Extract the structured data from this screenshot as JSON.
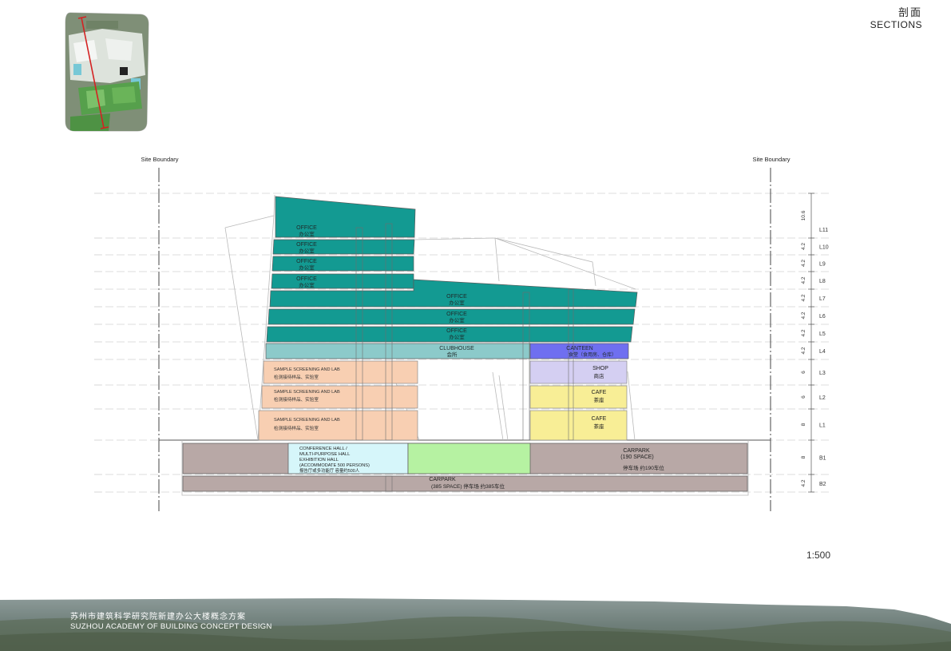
{
  "header": {
    "title_cn": "剖面",
    "title_en": "SECTIONS"
  },
  "boundary": {
    "left_label": "Site Boundary",
    "right_label": "Site Boundary"
  },
  "scale_text": "1:500",
  "footer": {
    "project_cn": "苏州市建筑科学研究院新建办公大楼概念方案",
    "project_en": "SUZHOU ACADEMY OF BUILDING CONCEPT DESIGN"
  },
  "levels": [
    {
      "name": "L11",
      "height": "10.6"
    },
    {
      "name": "L10",
      "height": "4.2"
    },
    {
      "name": "L9",
      "height": "4.2"
    },
    {
      "name": "L8",
      "height": "4.2"
    },
    {
      "name": "L7",
      "height": "4.2"
    },
    {
      "name": "L6",
      "height": "4.2"
    },
    {
      "name": "L5",
      "height": "4.2"
    },
    {
      "name": "L4",
      "height": "4.2"
    },
    {
      "name": "L3",
      "height": "6"
    },
    {
      "name": "L2",
      "height": "6"
    },
    {
      "name": "L1",
      "height": "8"
    },
    {
      "name": "B1",
      "height": "8"
    },
    {
      "name": "B2",
      "height": "4.2"
    }
  ],
  "spaces": {
    "office_en": "OFFICE",
    "office_cn": "办公室",
    "clubhouse_en": "CLUBHOUSE",
    "clubhouse_cn": "会所",
    "canteen_en": "CANTEEN",
    "canteen_cn": "食堂（食用房、仓库）",
    "shop_en": "SHOP",
    "shop_cn": "商店",
    "cafe_en": "CAFE",
    "cafe_cn": "茶座",
    "lab_en": "SAMPLE SCREENING AND LAB",
    "lab_cn": "检测接待样品、实验室",
    "conference_line1": "CONFERENCE HALL /",
    "conference_line2": "MULTI-PURPOSE HALL",
    "conference_line3": "EXHIBITION HALL",
    "conference_line4": "(ACCOMMODATE 500 PERSONS)",
    "conference_cn": "报告厅或多功能厅 容量约500人",
    "carpark_b1_en": "CARPARK",
    "carpark_b1_space": "(190 SPACE)",
    "carpark_b1_cn": "停车场 约190车位",
    "carpark_b2_en": "CARPARK",
    "carpark_b2_detail": "(385 SPACE)  停车场 约385车位"
  },
  "colors": {
    "office": "#139a92",
    "clubhouse": "#8ccaca",
    "canteen": "#6f6ff0",
    "shop": "#d4cff2",
    "cafe": "#f8ee96",
    "lab": "#f8cfb2",
    "conference": "#d6f6fa",
    "exhibition": "#b6f2a2",
    "carpark": "#b8a8a6"
  }
}
